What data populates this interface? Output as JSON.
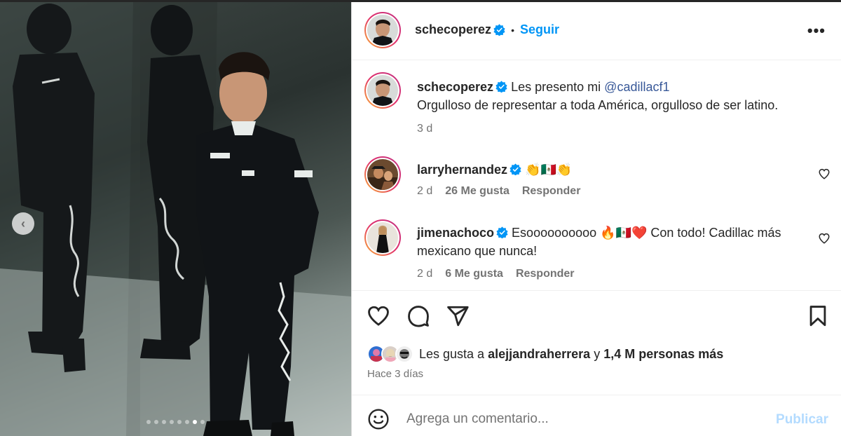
{
  "post": {
    "author": "schecoperez",
    "follow_label": "Seguir",
    "separator": "•",
    "more_label": "•••",
    "caption_author": "schecoperez",
    "caption_prefix": "Les presento mi",
    "caption_mention": "@cadillacf1",
    "caption_line2": "Orgulloso de representar a toda América, orgulloso de ser latino.",
    "caption_time": "3 d"
  },
  "comments": [
    {
      "username": "larryhernandez",
      "text": "👏🇲🇽👏",
      "time": "2 d",
      "likes": "26 Me gusta",
      "reply": "Responder"
    },
    {
      "username": "jimenachoco",
      "text": "Esoooooooooo 🔥🇲🇽❤️  Con todo! Cadillac más mexicano que nunca!",
      "time": "2 d",
      "likes": "6 Me gusta",
      "reply": "Responder"
    }
  ],
  "likes": {
    "prefix": "Les gusta a",
    "liker": "alejjandraherrera",
    "connector": "y",
    "count": "1,4 M personas más"
  },
  "timestamp": "Hace 3 días",
  "composer": {
    "placeholder": "Agrega un comentario...",
    "publish_label": "Publicar"
  },
  "carousel": {
    "slide_count": 8,
    "active_index": 6
  },
  "colors": {
    "accent": "#0095f6",
    "mention": "#385898",
    "muted": "#737373",
    "publish_disabled": "#b3dbff"
  }
}
